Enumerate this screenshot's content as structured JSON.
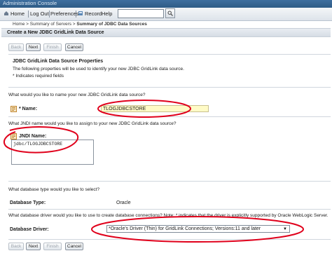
{
  "app": {
    "title": "Administration Console"
  },
  "nav": {
    "home": "Home",
    "logout": "Log Out",
    "preferences": "Preferences",
    "record": "Record",
    "help": "Help",
    "search_value": ""
  },
  "breadcrumb": {
    "home": "Home >",
    "servers": "Summary of Servers >",
    "current": "Summary of JDBC Data Sources"
  },
  "page": {
    "title": "Create a New JDBC GridLink Data Source",
    "section_title": "JDBC GridLink Data Source Properties",
    "description": "The following properties will be used to identify your new JDBC GridLink data source.",
    "required_note": "* Indicates required fields"
  },
  "buttons": {
    "back": "Back",
    "next": "Next",
    "finish": "Finish",
    "cancel": "Cancel"
  },
  "form": {
    "name_question": "What would you like to name your new JDBC GridLink data source?",
    "name_label": "* Name:",
    "name_value": "TLOGJDBCSTORE",
    "jndi_question": "What JNDI name would you like to assign to your new JDBC GridLink data source?",
    "jndi_label": "JNDI Name:",
    "jndi_value": "jdbc/TLOGJDBCSTORE",
    "db_type_question": "What database type would you like to select?",
    "db_type_label": "Database Type:",
    "db_type_value": "Oracle",
    "driver_question": "What database driver would you like to use to create database connections? Note: * indicates that the driver is explicitly supported by Oracle WebLogic Server.",
    "driver_label": "Database Driver:",
    "driver_value": "*Oracle's Driver (Thin) for GridLink Connections; Versions:11 and later"
  },
  "colors": {
    "annotation": "#e0001b",
    "name_field_bg": "#fffbc6",
    "header_bar": "#2e5b86"
  }
}
